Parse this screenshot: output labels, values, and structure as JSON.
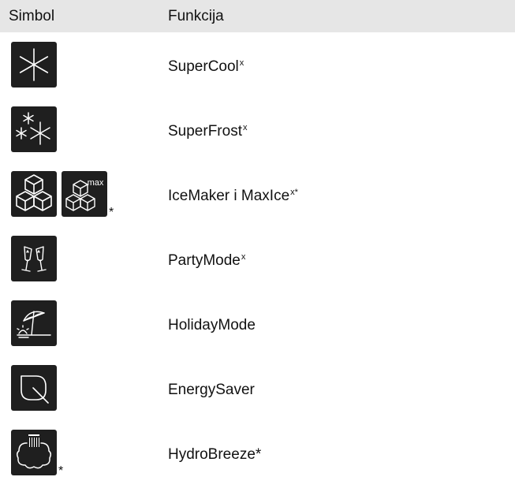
{
  "header": {
    "col_symbol": "Simbol",
    "col_function": "Funkcija"
  },
  "rows": [
    {
      "icons": [
        "snowflake-icon"
      ],
      "name": "SuperCool",
      "sup": "x",
      "star": ""
    },
    {
      "icons": [
        "snowflakes-icon"
      ],
      "name": "SuperFrost",
      "sup": "x",
      "star": ""
    },
    {
      "icons": [
        "ice-cubes-icon",
        "ice-cubes-max-icon"
      ],
      "name": "IceMaker i MaxIce",
      "sup": "x*",
      "star": "*",
      "max_label": "max"
    },
    {
      "icons": [
        "champagne-glasses-icon"
      ],
      "name": "PartyMode",
      "sup": "x",
      "star": ""
    },
    {
      "icons": [
        "beach-umbrella-icon"
      ],
      "name": "HolidayMode",
      "sup": "",
      "star": ""
    },
    {
      "icons": [
        "leaf-icon"
      ],
      "name": "EnergySaver",
      "sup": "",
      "star": ""
    },
    {
      "icons": [
        "hydrobreeze-icon"
      ],
      "name": "HydroBreeze*",
      "sup": "",
      "star": "*"
    }
  ],
  "colors": {
    "header_bg": "#e6e6e6",
    "icon_bg": "#1f1f1f",
    "icon_fg": "#ffffff"
  }
}
